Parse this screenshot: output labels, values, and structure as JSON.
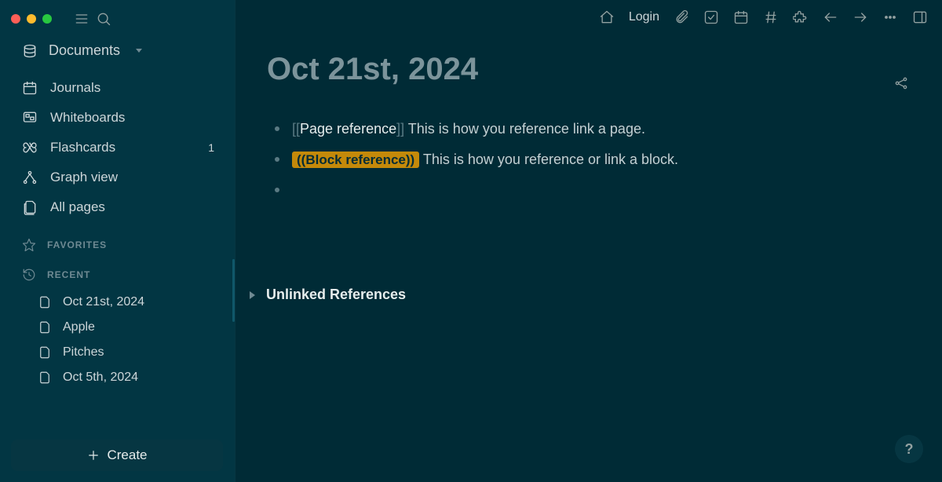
{
  "sidebar": {
    "workspace_label": "Documents",
    "nav": {
      "journals": "Journals",
      "whiteboards": "Whiteboards",
      "flashcards": "Flashcards",
      "flashcards_count": "1",
      "graph_view": "Graph view",
      "all_pages": "All pages"
    },
    "favorites_heading": "FAVORITES",
    "recent_heading": "RECENT",
    "recent": [
      "Oct 21st, 2024",
      "Apple",
      "Pitches",
      "Oct 5th, 2024"
    ],
    "create_label": "Create"
  },
  "topbar": {
    "login": "Login"
  },
  "page": {
    "title": "Oct 21st, 2024",
    "blocks": [
      {
        "page_ref_text": "Page reference",
        "tail": " This is how you reference link a page."
      },
      {
        "block_ref_chip": "((Block reference))",
        "tail": " This is how you reference or link a block."
      },
      {
        "tail": ""
      }
    ],
    "unlinked_label": "Unlinked References"
  },
  "help": "?"
}
